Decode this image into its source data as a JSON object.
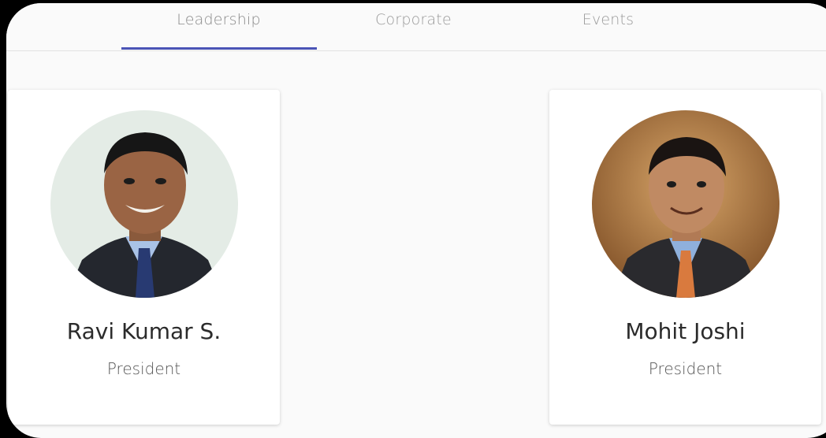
{
  "tabs": [
    {
      "label": "Leadership",
      "active": true
    },
    {
      "label": "Corporate",
      "active": false
    },
    {
      "label": "Events",
      "active": false
    }
  ],
  "accent_color": "#4a54b6",
  "people": [
    {
      "name": "Ravi Kumar S.",
      "role": "President",
      "photo_icon": "person-photo"
    },
    {
      "name": "Mohit Joshi",
      "role": "President",
      "photo_icon": "person-photo"
    }
  ]
}
